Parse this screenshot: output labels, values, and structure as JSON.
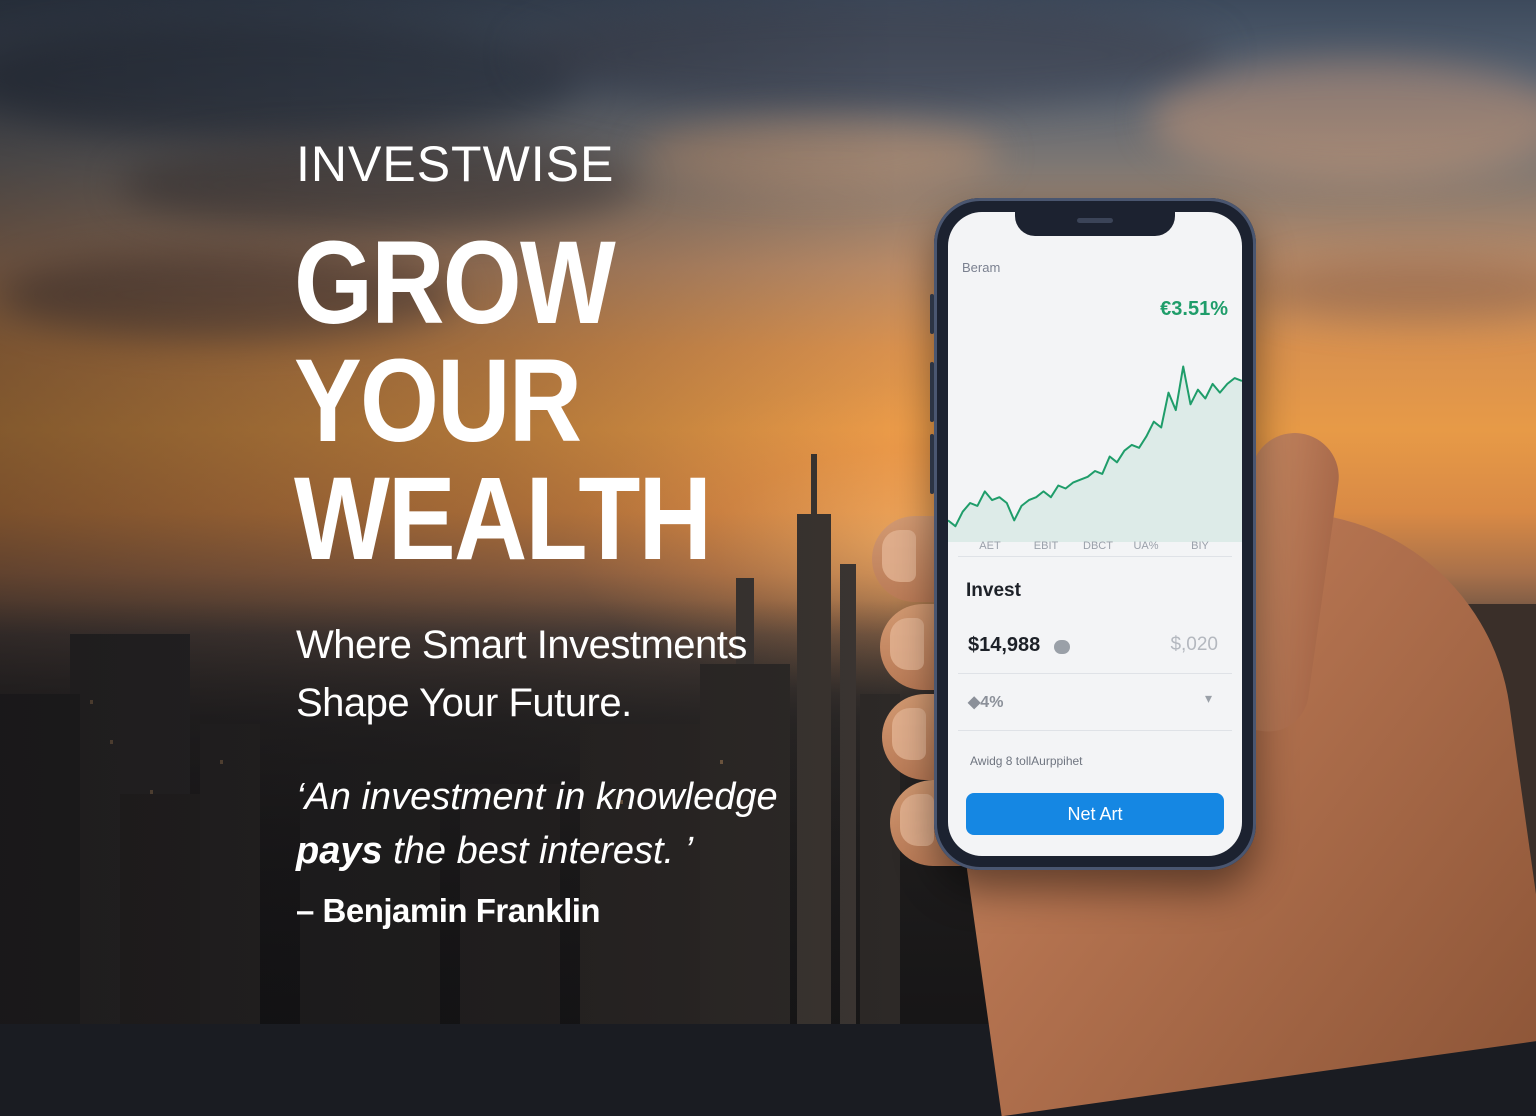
{
  "brand": "INVESTWISE",
  "headline": [
    "GROW",
    "YOUR",
    "WEALTH"
  ],
  "subhead": [
    "Where Smart Investments",
    "Shape Your Future."
  ],
  "quote": {
    "open_mark": "‘",
    "line1": "An investment in knowledge",
    "emphasis": "pays",
    "line2_rest": " the best interest.",
    "close_mark": " ’",
    "attribution": "– Benjamin Franklin"
  },
  "phone": {
    "app_name": "Beram",
    "gain": "€3.51%",
    "x_ticks": [
      "AET",
      "EBIT",
      "DBCT",
      "UA%",
      "BIY"
    ],
    "section_title": "Invest",
    "balance": "$14,988",
    "balance_secondary": "$,020",
    "percent": "◆4%",
    "chevron": "▾",
    "footnote": "Awidg 8 tollAurppihet",
    "cta_label": "Net Art"
  },
  "chart_data": {
    "type": "area",
    "title": "",
    "xlabel": "",
    "ylabel": "",
    "x": [
      0,
      1,
      2,
      3,
      4,
      5,
      6,
      7,
      8,
      9,
      10,
      11,
      12,
      13,
      14,
      15,
      16,
      17,
      18,
      19,
      20,
      21,
      22,
      23,
      24,
      25,
      26,
      27,
      28,
      29,
      30,
      31,
      32,
      33,
      34,
      35,
      36,
      37,
      38,
      39,
      40
    ],
    "series": [
      {
        "values": [
          2,
          0,
          5,
          8,
          7,
          12,
          9,
          10,
          8,
          2,
          7,
          9,
          10,
          12,
          10,
          14,
          13,
          15,
          16,
          17,
          19,
          18,
          24,
          22,
          26,
          28,
          27,
          31,
          36,
          34,
          46,
          40,
          55,
          42,
          47,
          44,
          49,
          46,
          49,
          51,
          50
        ]
      }
    ],
    "ylim": [
      -2,
      60
    ],
    "color": "#1f9d6a",
    "grid": false
  },
  "colors": {
    "accent": "#1587e3",
    "gain": "#1f9d6a"
  }
}
